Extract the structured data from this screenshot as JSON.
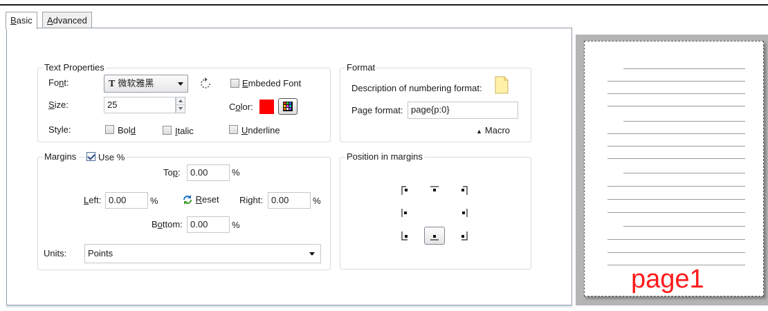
{
  "tabs": [
    {
      "label": "Basic",
      "accel": "B",
      "rest": "asic",
      "active": true
    },
    {
      "label": "Advanced",
      "accel": "A",
      "rest": "dvanced",
      "active": false
    }
  ],
  "text_properties": {
    "title": "Text Properties",
    "font_label_pre": "Fo",
    "font_label_accel": "n",
    "font_label_post": "t:",
    "font_value": "微软雅黑",
    "font_type_glyph": "T",
    "embeded_font_accel": "E",
    "embeded_font_rest": "mbeded Font",
    "embeded_font_checked": false,
    "size_label_accel": "S",
    "size_label_rest": "ize:",
    "size_value": "25",
    "color_label_pre": "C",
    "color_label_accel": "o",
    "color_label_post": "lor:",
    "color_value": "#ff0000",
    "style_label": "Style:",
    "bold_pre": "Bol",
    "bold_accel": "d",
    "bold_checked": false,
    "italic_accel": "I",
    "italic_rest": "talic",
    "italic_checked": false,
    "underline_accel": "U",
    "underline_rest": "nderline",
    "underline_checked": false
  },
  "format": {
    "title": "Format",
    "description_label": "Description of numbering format:",
    "page_format_pre": "Pa",
    "page_format_accel": "g",
    "page_format_post": "e format:",
    "page_format_value": "page{p:0}",
    "macro_label": "Macro",
    "macro_arrow": "▲"
  },
  "margins": {
    "title": "Margins",
    "use_percent_label": "Use %",
    "use_percent_checked": true,
    "top_pre": "To",
    "top_accel": "p",
    "top_post": ":",
    "top_value": "0.00",
    "left_accel": "L",
    "left_rest": "eft:",
    "left_value": "0.00",
    "right_pre": "Ri",
    "right_accel": "g",
    "right_post": "ht:",
    "right_value": "0.00",
    "bottom_pre": "B",
    "bottom_accel": "o",
    "bottom_post": "ttom:",
    "bottom_value": "0.00",
    "percent": "%",
    "reset_accel": "R",
    "reset_rest": "eset",
    "units_label": "Units:",
    "units_value": "Points"
  },
  "position": {
    "title": "Position in margins",
    "selected": "bottom-center"
  },
  "preview": {
    "page_label": "page1",
    "page_label_color": "#ff1a1a"
  }
}
